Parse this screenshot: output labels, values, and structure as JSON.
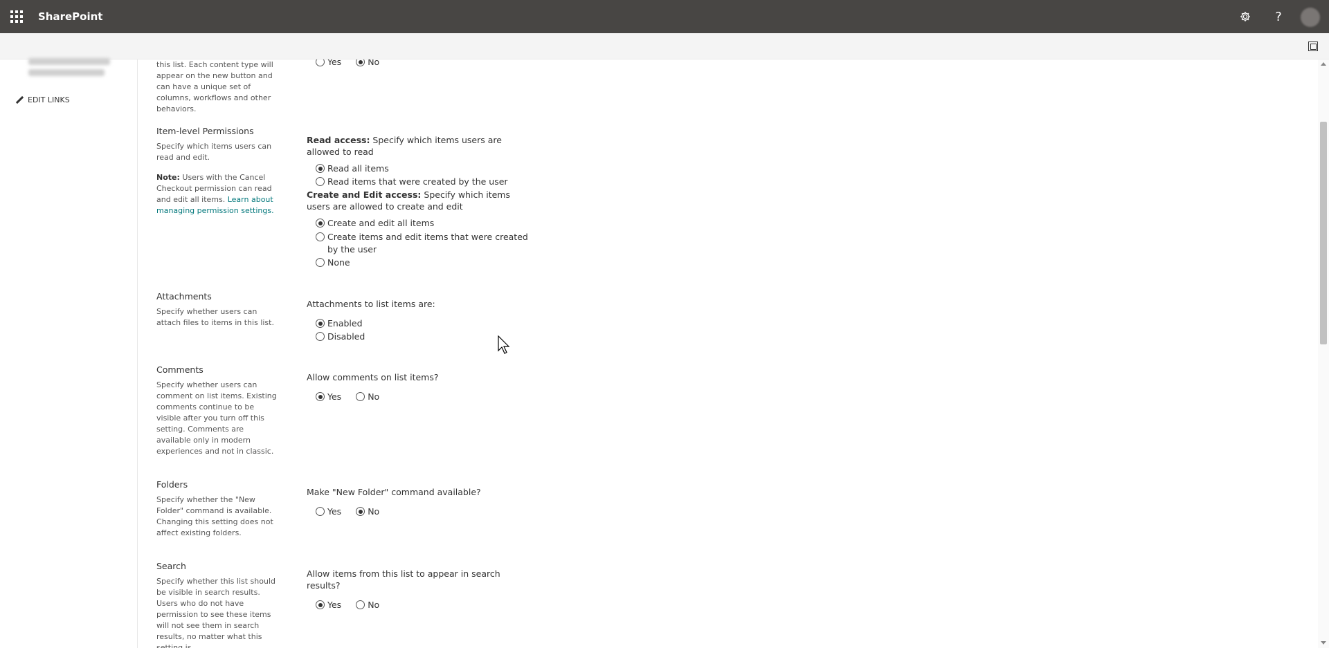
{
  "suitebar": {
    "brand": "SharePoint",
    "icons": [
      "app-launcher-icon",
      "gear-icon",
      "help-icon",
      "avatar"
    ],
    "help_glyph": "?"
  },
  "leftnav": {
    "edit_links": "EDIT LINKS"
  },
  "sections": {
    "content_types": {
      "desc": "this list. Each content type will appear on the new button and can have a unique set of columns, workflows and other behaviors.",
      "yes": "Yes",
      "no": "No"
    },
    "item_permissions": {
      "title": "Item-level Permissions",
      "desc": "Specify which items users can read and edit.",
      "note_label": "Note:",
      "note_text": " Users with the Cancel Checkout permission can read and edit all items. ",
      "note_link": "Learn about managing permission settings.",
      "read_label": "Read access:",
      "read_text": "  Specify which items users are allowed to read",
      "read_options": [
        "Read all items",
        "Read items that were created by the user"
      ],
      "create_label": "Create and Edit access:",
      "create_text": "  Specify which items users are allowed to create and edit",
      "create_options": [
        "Create and edit all items",
        "Create items and edit items that were created by the user",
        "None"
      ]
    },
    "attachments": {
      "title": "Attachments",
      "desc": "Specify whether users can attach files to items in this list.",
      "question": "Attachments to list items are:",
      "options": [
        "Enabled",
        "Disabled"
      ]
    },
    "comments": {
      "title": "Comments",
      "desc": "Specify whether users can comment on list items. Existing comments continue to be visible after you turn off this setting. Comments are available only in modern experiences and not in classic.",
      "question": "Allow comments on list items?",
      "yes": "Yes",
      "no": "No"
    },
    "folders": {
      "title": "Folders",
      "desc": "Specify whether the \"New Folder\" command is available. Changing this setting does not affect existing folders.",
      "question": "Make \"New Folder\" command available?",
      "yes": "Yes",
      "no": "No"
    },
    "search": {
      "title": "Search",
      "desc": "Specify whether this list should be visible in search results. Users who do not have permission to see these items will not see them in search results, no matter what this setting is.",
      "question": "Allow items from this list to appear in search results?",
      "yes": "Yes",
      "no": "No"
    }
  }
}
